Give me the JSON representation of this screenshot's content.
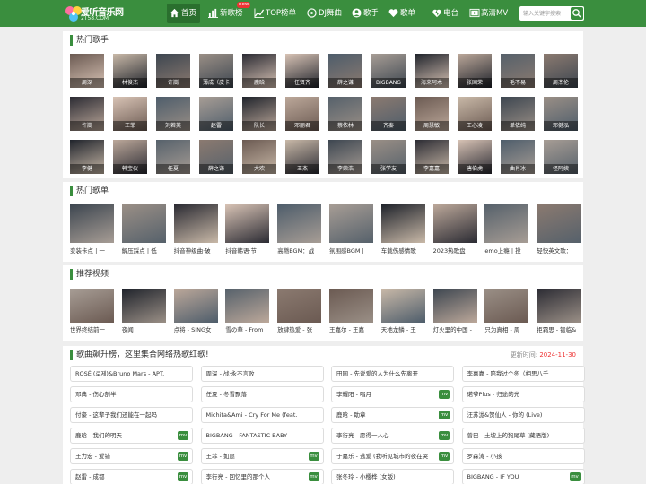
{
  "header": {
    "logo_text": "爱听音乐网",
    "logo_domain": "2T58.COM",
    "nav": [
      {
        "label": "首页",
        "icon": "home-icon"
      },
      {
        "label": "新歌榜",
        "icon": "bar-chart-icon"
      },
      {
        "label": "TOP榜单",
        "icon": "trend-icon"
      },
      {
        "label": "DJ舞曲",
        "icon": "disc-icon"
      },
      {
        "label": "歌手",
        "icon": "user-icon"
      },
      {
        "label": "歌单",
        "icon": "heart-icon"
      },
      {
        "label": "电台",
        "icon": "radio-icon"
      },
      {
        "label": "高清MV",
        "icon": "video-icon"
      }
    ],
    "new_badge": "new",
    "search_placeholder": "输入关键字搜索"
  },
  "colors": {
    "brand": "#3a8e3e",
    "accent_red": "#e33"
  },
  "hot_singers": {
    "title": "热门歌手",
    "rows": [
      [
        "周深",
        "林俊杰",
        "许嵩",
        "薄成（皮卡",
        "鹿晗",
        "任贤齐",
        "薛之谦",
        "BIGBANG",
        "海来阿木",
        "张国荣",
        "毛不易",
        "周杰伦"
      ],
      [
        "许嵩",
        "王菲",
        "刘若英",
        "赵雷",
        "队长",
        "邓丽君",
        "蔡依林",
        "齐秦",
        "周慧敏",
        "王心凌",
        "单依纯",
        "邓健泓"
      ],
      [
        "李健",
        "韩宝仪",
        "任夏",
        "薛之谦",
        "大欢",
        "王杰",
        "李荣浩",
        "张学友",
        "李嘉嘉",
        "唐伯虎",
        "曲肖冰",
        "怪阿姨"
      ]
    ]
  },
  "hot_playlists": {
    "title": "热门歌单",
    "items": [
      "变装卡点丨一",
      "解压踩点丨低",
      "抖音神级曲·破",
      "抖音韩语·节",
      "高燃BGM：战",
      "氛围感BGM丨",
      "车载伤感情歌",
      "2023热歌盘",
      "emo上瘾丨投",
      "轻快英文歌："
    ]
  },
  "recommended_videos": {
    "title": "推荐视频",
    "items": [
      "世界终结前一",
      "夜闻",
      "点将 - SING女",
      "雪の華 - From",
      "放肆热爱 - 张",
      "王嘉尔 - 王嘉",
      "天地龙鳞 - 王",
      "灯火里的中国 -",
      "只为真相 - 周",
      "拒霜思 - 锻临&"
    ]
  },
  "chart": {
    "title": "歌曲飙升榜，这里集合网络热歌红歌!",
    "updated_label": "更新时间:",
    "updated_date": "2024-11-30",
    "mv_label": "mv",
    "rows": [
      [
        {
          "t": "ROSÉ (로제)&Bruno Mars - APT.",
          "mv": false
        },
        {
          "t": "周深 - 战·永不言败",
          "mv": false
        },
        {
          "t": "田园 - 先说爱的人为什么先离开",
          "mv": false
        },
        {
          "t": "李嘉嘉 - 陪我过个冬（相思八千",
          "mv": false
        }
      ],
      [
        {
          "t": "邓典 - 伤心剖半",
          "mv": false
        },
        {
          "t": "任夏 - 冬雪飘落",
          "mv": false
        },
        {
          "t": "李耀阳 - 唱月",
          "mv": true
        },
        {
          "t": "诺爷Plus - 归途的光",
          "mv": false
        }
      ],
      [
        {
          "t": "付豪 - 这辈子我们还能在一起吗",
          "mv": false
        },
        {
          "t": "Michita&Ami - Cry For Me (feat.",
          "mv": false
        },
        {
          "t": "鹿晗 - 助章",
          "mv": true
        },
        {
          "t": "汪苏泷&贺仙人 - 你的 (Live)",
          "mv": false
        }
      ],
      [
        {
          "t": "鹿晗 - 我们的明天",
          "mv": true
        },
        {
          "t": "BIGBANG - FANTASTIC BABY",
          "mv": false
        },
        {
          "t": "李行亮 - 愿得一人心",
          "mv": true
        },
        {
          "t": "曾巴 - 土坡上的狗尾草 (藏语版)",
          "mv": false
        }
      ],
      [
        {
          "t": "王力宏 - 爱错",
          "mv": true
        },
        {
          "t": "王菲 - 如愿",
          "mv": true
        },
        {
          "t": "于嘉乐 - 逃爱 (我听见城市的夜在哭",
          "mv": true
        },
        {
          "t": "罗森涛 - 小孩",
          "mv": false
        }
      ],
      [
        {
          "t": "赵雷 - 成都",
          "mv": true
        },
        {
          "t": "李行亮 - 回忆里的那个人",
          "mv": true
        },
        {
          "t": "张冬玲 - 小樱桦 (女版)",
          "mv": false
        },
        {
          "t": "BIGBANG - IF YOU",
          "mv": true
        }
      ]
    ]
  }
}
